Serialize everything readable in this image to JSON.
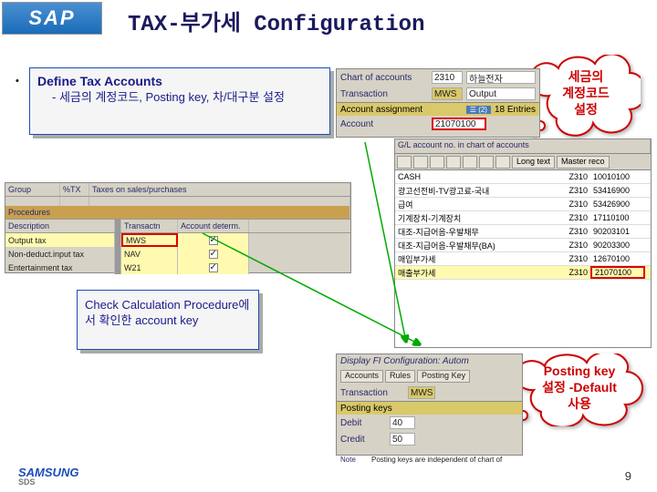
{
  "logo": "SAP",
  "title": "TAX-부가세 Configuration",
  "define_box": {
    "heading": "Define Tax Accounts",
    "sub": "- 세금의 계정코드, Posting key, 차/대구분 설정"
  },
  "callout1": "세금의\n계정코드\n설정",
  "callout2": "Posting key\n설정 -Default\n사용",
  "check_box": "Check Calculation Procedure에서 확인한 account key",
  "panel_top": {
    "chart_label": "Chart of accounts",
    "chart_val": "2310",
    "chart_desc": "하늘전자",
    "trans_label": "Transaction",
    "trans_val": "MWS",
    "trans_desc": "Output",
    "assign": "Account assignment",
    "entries": "18 Entries",
    "acct_label": "Account",
    "acct_val": "21070100"
  },
  "panel_list": {
    "hdr_gl": "G/L account no. in chart of accounts",
    "tool_long": "Long text",
    "tool_mr": "Master reco",
    "rows": [
      {
        "t": "CASH",
        "a": "Z310",
        "n": "10010100"
      },
      {
        "t": "광고선전비-TV광고료-국내",
        "a": "Z310",
        "n": "53416900"
      },
      {
        "t": "급여",
        "a": "Z310",
        "n": "53426900"
      },
      {
        "t": "기계장치-기계장치",
        "a": "Z310",
        "n": "17110100"
      },
      {
        "t": "대조-지급어음-우발채무",
        "a": "Z310",
        "n": "90203101"
      },
      {
        "t": "대조-지급어음-우발채무(BA)",
        "a": "Z310",
        "n": "90203300"
      },
      {
        "t": "매입부가세",
        "a": "Z310",
        "n": "12670100"
      },
      {
        "t": "매출부가세",
        "a": "Z310",
        "n": "21070100",
        "hl": true
      }
    ]
  },
  "panel_left": {
    "grp_h": [
      "Group",
      "%TX",
      "Taxes on sales/purchases"
    ],
    "proc_h": [
      "Procedures",
      "",
      ""
    ],
    "cols": [
      "Description",
      "Transactn",
      "Account determ."
    ],
    "rows": [
      {
        "d": "Output tax",
        "t": "MWS",
        "c": true,
        "hl": true,
        "red_t": true
      },
      {
        "d": "Non-deduct.input tax",
        "t": "NAV",
        "c": true
      },
      {
        "d": "Entertainment tax",
        "t": "W21",
        "c": true
      }
    ]
  },
  "panel_bot": {
    "title": "Display FI Configuration: Autom",
    "tabs": [
      "Accounts",
      "Rules",
      "Posting Key"
    ],
    "trans_label": "Transaction",
    "trans_val": "MWS",
    "pk": "Posting keys",
    "debit": "Debit",
    "debit_v": "40",
    "credit": "Credit",
    "credit_v": "50",
    "note": "Note",
    "note_t": "Posting keys are independent of chart of"
  },
  "footer": {
    "brand": "SAMSUNG",
    "sub": "SDS",
    "page": "9"
  }
}
